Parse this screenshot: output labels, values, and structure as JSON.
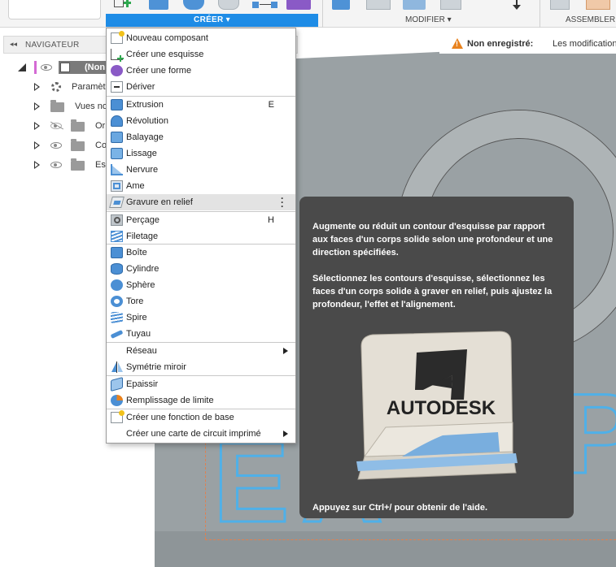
{
  "toolbar": {
    "create_label": "CRÉER ▾",
    "modify_label": "MODIFIER ▾",
    "assemble_label": "ASSEMBLER"
  },
  "browser": {
    "title": "NAVIGATEUR",
    "root_label": "(Non",
    "items": [
      {
        "label": "Paramèt",
        "icon": "gear-icon"
      },
      {
        "label": "Vues no",
        "icon": "folder-icon"
      },
      {
        "label": "Or",
        "icon": "folder-icon",
        "hidden": true
      },
      {
        "label": "Co",
        "icon": "folder-icon"
      },
      {
        "label": "Es",
        "icon": "folder-icon"
      }
    ]
  },
  "status": {
    "bold": "Non enregistré:",
    "text": "Les modification"
  },
  "menu": {
    "items": [
      {
        "label": "Nouveau composant",
        "icon": "new-component-icon"
      },
      {
        "label": "Créer une esquisse",
        "icon": "sketch-icon"
      },
      {
        "label": "Créer une forme",
        "icon": "form-icon"
      },
      {
        "label": "Dériver",
        "icon": "derive-icon"
      },
      {
        "label": "Extrusion",
        "shortcut": "E",
        "icon": "extrude-icon"
      },
      {
        "label": "Révolution",
        "icon": "revolve-icon"
      },
      {
        "label": "Balayage",
        "icon": "sweep-icon"
      },
      {
        "label": "Lissage",
        "icon": "loft-icon"
      },
      {
        "label": "Nervure",
        "icon": "rib-icon"
      },
      {
        "label": "Ame",
        "icon": "web-icon"
      },
      {
        "label": "Gravure en relief",
        "icon": "emboss-icon"
      },
      {
        "label": "Perçage",
        "shortcut": "H",
        "icon": "hole-icon"
      },
      {
        "label": "Filetage",
        "icon": "thread-icon"
      },
      {
        "label": "Boîte",
        "icon": "box-icon"
      },
      {
        "label": "Cylindre",
        "icon": "cylinder-icon"
      },
      {
        "label": "Sphère",
        "icon": "sphere-icon"
      },
      {
        "label": "Tore",
        "icon": "torus-icon"
      },
      {
        "label": "Spire",
        "icon": "coil-icon"
      },
      {
        "label": "Tuyau",
        "icon": "pipe-icon"
      },
      {
        "label": "Réseau",
        "icon": "none"
      },
      {
        "label": "Symétrie miroir",
        "icon": "mirror-icon"
      },
      {
        "label": "Epaissir",
        "icon": "thicken-icon"
      },
      {
        "label": "Remplissage de limite",
        "icon": "boundary-fill-icon"
      },
      {
        "label": "Créer une fonction de base",
        "icon": "base-feature-icon"
      },
      {
        "label": "Créer une carte de circuit imprimé",
        "icon": "none"
      }
    ]
  },
  "tooltip": {
    "para1": "Augmente ou réduit un contour d'esquisse par rapport aux faces d'un corps solide selon une profondeur et une direction spécifiées.",
    "para2": "Sélectionnez les contours d'esquisse, sélectionnez les faces d'un corps solide à graver en relief, puis ajustez la profondeur, l'effet et l'alignement.",
    "logo_text": "AUTODESK",
    "footer": "Appuyez sur Ctrl+/ pour obtenir de l'aide."
  },
  "colors": {
    "accent": "#1e8ce6",
    "tooltip_bg": "#4a4a4a",
    "emboss_blue": "#4fb0e8",
    "warning": "#e8821e"
  }
}
